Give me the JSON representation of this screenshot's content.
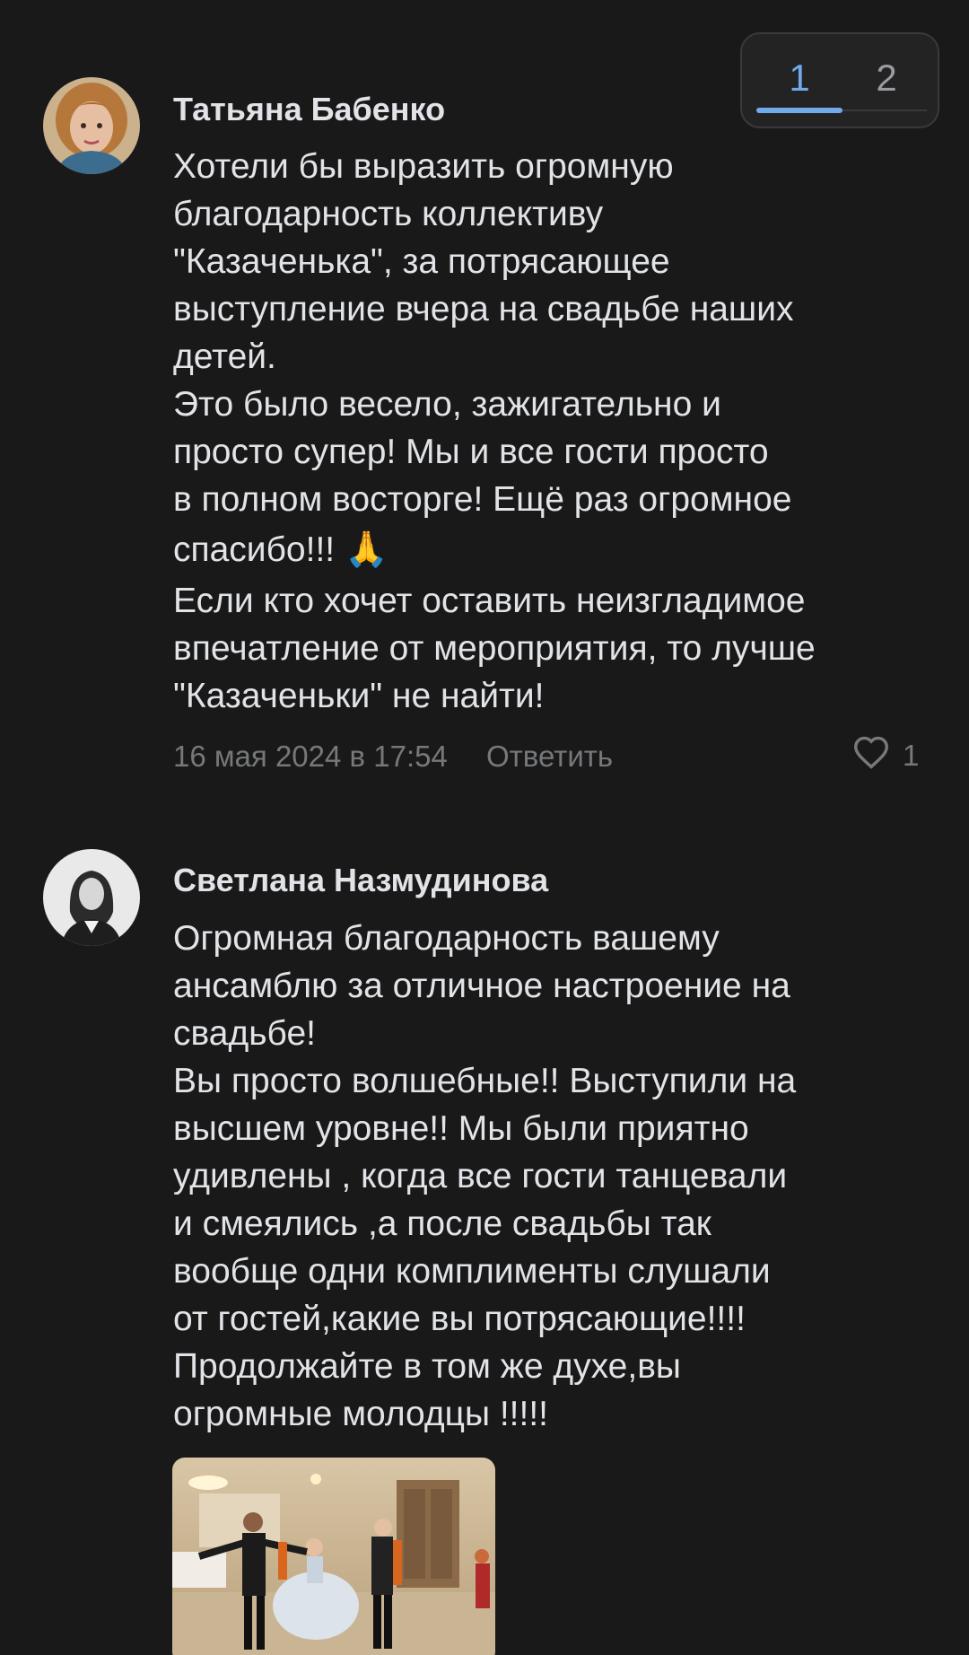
{
  "pager": {
    "tabs": [
      "1",
      "2"
    ],
    "active_index": 0
  },
  "colors": {
    "background": "#19191a",
    "accent": "#71aaeb",
    "muted": "#76787a",
    "text": "#e1e3e6"
  },
  "comments": [
    {
      "author": "Татьяна Бабенко",
      "text_lines": [
        "Хотели бы выразить огромную",
        "благодарность коллективу",
        "\"Казаченька\",  за потрясающее",
        "выступление вчера на свадьбе наших",
        "детей.",
        "Это было  весело, зажигательно и",
        "просто супер!  Мы и все гости просто",
        "в полном восторге! Ещё раз огромное",
        "спасибо!!! 🙏",
        "Если кто хочет оставить неизгладимое",
        "впечатление от мероприятия, то лучше",
        "\"Казаченьки\" не найти!"
      ],
      "date": "16 мая 2024 в 17:54",
      "reply_label": "Ответить",
      "likes": "1",
      "like_icon": "heart-outline-icon"
    },
    {
      "author": "Светлана Назмудинова",
      "text_lines": [
        "Огромная благодарность вашему",
        "ансамблю за отличное настроение на",
        "свадьбе!",
        "Вы просто волшебные!! Выступили на",
        "высшем уровне!! Мы были приятно",
        "удивлены , когда все гости танцевали",
        "и смеялись ,а после свадьбы так",
        "вообще одни комплименты  слушали",
        "от гостей,какие вы потрясающие!!!!",
        "Продолжайте в том же духе,вы",
        "огромные молодцы !!!!!"
      ],
      "has_photo": true
    }
  ]
}
